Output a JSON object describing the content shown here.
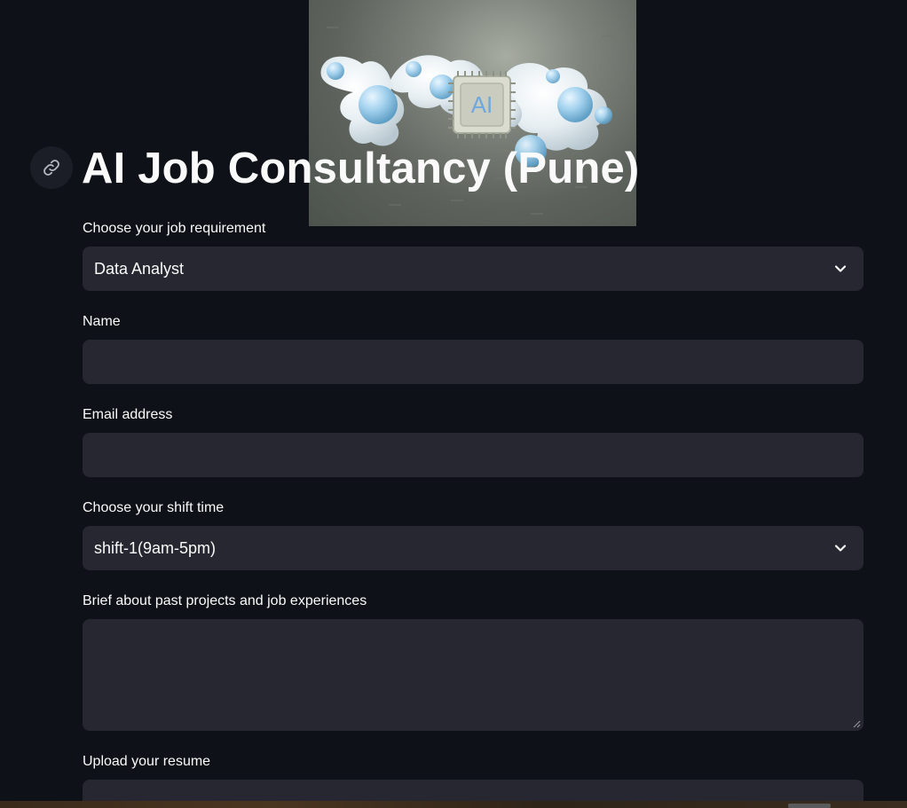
{
  "page": {
    "title": "AI Job Consultancy (Pune)"
  },
  "hero": {
    "badge_text": "AI",
    "icon": "ai-chip-image"
  },
  "form": {
    "job_requirement": {
      "label": "Choose your job requirement",
      "selected": "Data Analyst"
    },
    "name": {
      "label": "Name",
      "value": ""
    },
    "email": {
      "label": "Email address",
      "value": ""
    },
    "shift_time": {
      "label": "Choose your shift time",
      "selected": "shift-1(9am-5pm)"
    },
    "experience": {
      "label": "Brief about past projects and job experiences",
      "value": ""
    },
    "resume": {
      "label": "Upload your resume"
    }
  },
  "colors": {
    "background": "#0e1117",
    "input_background": "#262730",
    "text": "#fafafa"
  }
}
